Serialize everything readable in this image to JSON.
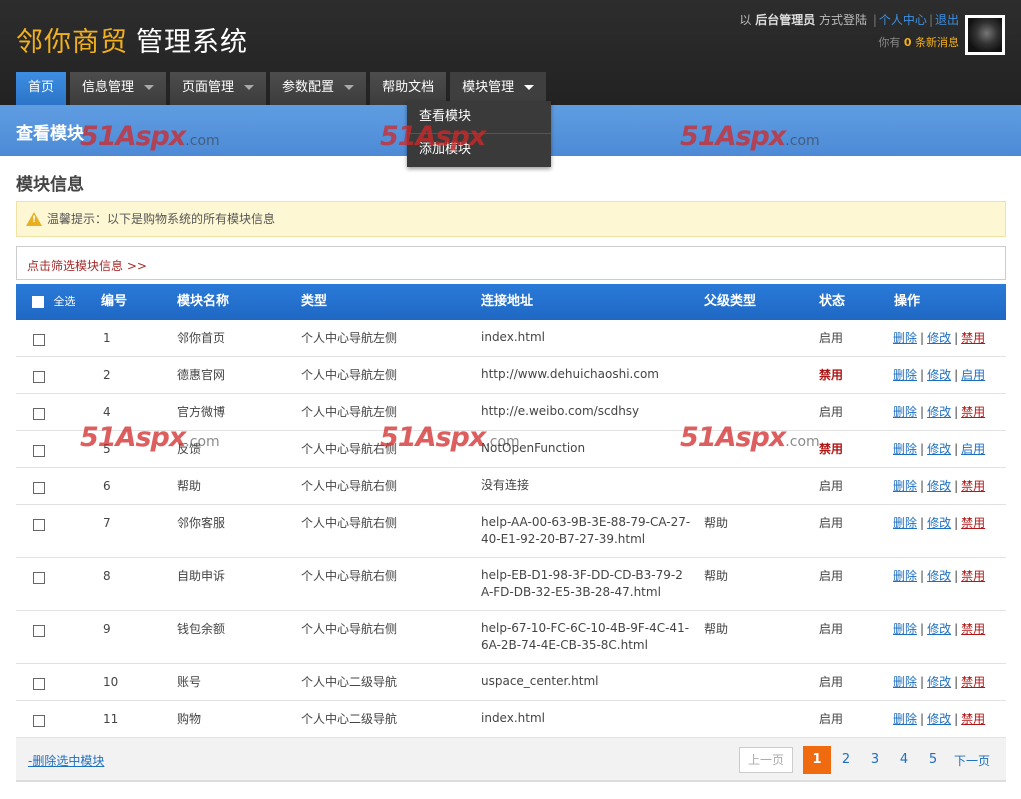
{
  "header": {
    "logo_brand": "邻你商贸",
    "logo_system": "管理系统",
    "login_prefix": "以",
    "login_role": "后台管理员",
    "login_suffix": "方式登陆",
    "user_center": "个人中心",
    "logout": "退出",
    "msg_prefix": "你有",
    "msg_count": "0",
    "msg_suffix": "条新消息"
  },
  "nav": {
    "items": [
      {
        "label": "首页"
      },
      {
        "label": "信息管理"
      },
      {
        "label": "页面管理"
      },
      {
        "label": "参数配置"
      },
      {
        "label": "帮助文档"
      },
      {
        "label": "模块管理"
      }
    ],
    "dropdown": [
      "查看模块",
      "添加模块"
    ]
  },
  "page": {
    "banner_title": "查看模块",
    "section_title": "模块信息",
    "tip": "温馨提示：以下是购物系统的所有模块信息",
    "filter": "点击筛选模块信息 >>",
    "watermark_brand": "51Aspx",
    "watermark_domain": ".com"
  },
  "table": {
    "headers": {
      "all": "全选",
      "id": "编号",
      "name": "模块名称",
      "type": "类型",
      "url": "连接地址",
      "parent": "父级类型",
      "status": "状态",
      "ops": "操作"
    },
    "ops": {
      "delete": "删除",
      "edit": "修改",
      "disable": "禁用",
      "enable": "启用",
      "sep": "|"
    },
    "rows": [
      {
        "id": "1",
        "name": "邻你首页",
        "type": "个人中心导航左侧",
        "url": "index.html",
        "parent": "",
        "status": "启用",
        "toggle": "禁用"
      },
      {
        "id": "2",
        "name": "德惠官网",
        "type": "个人中心导航左侧",
        "url": "http://www.dehuichaoshi.com",
        "parent": "",
        "status": "禁用",
        "toggle": "启用"
      },
      {
        "id": "4",
        "name": "官方微博",
        "type": "个人中心导航左侧",
        "url": "http://e.weibo.com/scdhsy",
        "parent": "",
        "status": "启用",
        "toggle": "禁用"
      },
      {
        "id": "5",
        "name": "反馈",
        "type": "个人中心导航右侧",
        "url": "NotOpenFunction",
        "parent": "",
        "status": "禁用",
        "toggle": "启用"
      },
      {
        "id": "6",
        "name": "帮助",
        "type": "个人中心导航右侧",
        "url": "没有连接",
        "parent": "",
        "status": "启用",
        "toggle": "禁用"
      },
      {
        "id": "7",
        "name": "邻你客服",
        "type": "个人中心导航右侧",
        "url": "help-AA-00-63-9B-3E-88-79-CA-27-40-E1-92-20-B7-27-39.html",
        "parent": "帮助",
        "status": "启用",
        "toggle": "禁用"
      },
      {
        "id": "8",
        "name": "自助申诉",
        "type": "个人中心导航右侧",
        "url": "help-EB-D1-98-3F-DD-CD-B3-79-2A-FD-DB-32-E5-3B-28-47.html",
        "parent": "帮助",
        "status": "启用",
        "toggle": "禁用"
      },
      {
        "id": "9",
        "name": "钱包余额",
        "type": "个人中心导航右侧",
        "url": "help-67-10-FC-6C-10-4B-9F-4C-41-6A-2B-74-4E-CB-35-8C.html",
        "parent": "帮助",
        "status": "启用",
        "toggle": "禁用"
      },
      {
        "id": "10",
        "name": "账号",
        "type": "个人中心二级导航",
        "url": "uspace_center.html",
        "parent": "",
        "status": "启用",
        "toggle": "禁用"
      },
      {
        "id": "11",
        "name": "购物",
        "type": "个人中心二级导航",
        "url": "index.html",
        "parent": "",
        "status": "启用",
        "toggle": "禁用"
      }
    ]
  },
  "footer": {
    "delete_selected": "-删除选中模块",
    "prev": "上一页",
    "pages": [
      "1",
      "2",
      "3",
      "4",
      "5"
    ],
    "current_page": "1",
    "next": "下一页"
  }
}
